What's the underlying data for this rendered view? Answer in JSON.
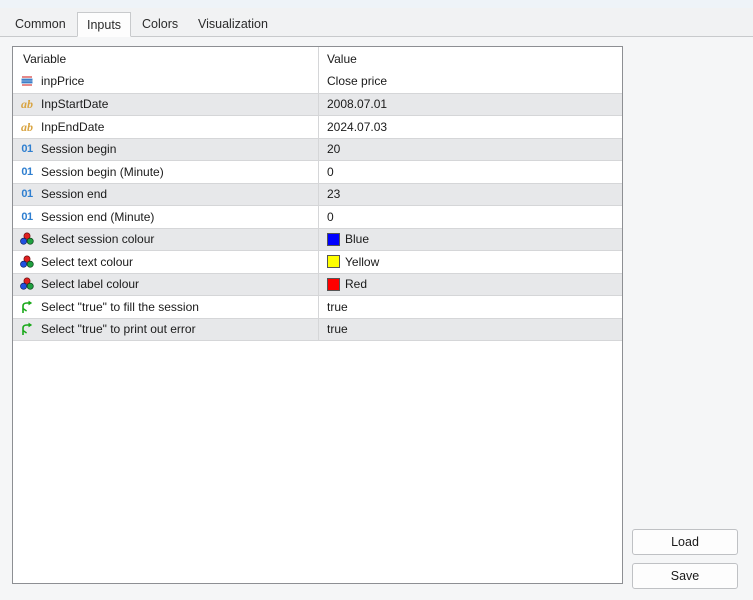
{
  "window": {
    "tabs": [
      {
        "label": "Common",
        "active": false
      },
      {
        "label": "Inputs",
        "active": true
      },
      {
        "label": "Colors",
        "active": false
      },
      {
        "label": "Visualization",
        "active": false
      }
    ]
  },
  "table": {
    "headers": {
      "variable": "Variable",
      "value": "Value"
    },
    "rows": [
      {
        "icon": "price-type-icon",
        "label": "inpPrice",
        "value": "Close price",
        "swatch": null
      },
      {
        "icon": "string-ab-icon",
        "label": "InpStartDate",
        "value": "2008.07.01",
        "swatch": null
      },
      {
        "icon": "string-ab-icon",
        "label": "InpEndDate",
        "value": "2024.07.03",
        "swatch": null
      },
      {
        "icon": "integer-01-icon",
        "label": "Session begin",
        "value": "20",
        "swatch": null
      },
      {
        "icon": "integer-01-icon",
        "label": "Session begin (Minute)",
        "value": "0",
        "swatch": null
      },
      {
        "icon": "integer-01-icon",
        "label": "Session end",
        "value": "23",
        "swatch": null
      },
      {
        "icon": "integer-01-icon",
        "label": "Session end (Minute)",
        "value": "0",
        "swatch": null
      },
      {
        "icon": "color-circles-icon",
        "label": "Select session colour",
        "value": "Blue",
        "swatch": "#0000FF"
      },
      {
        "icon": "color-circles-icon",
        "label": "Select text colour",
        "value": "Yellow",
        "swatch": "#FFFF00"
      },
      {
        "icon": "color-circles-icon",
        "label": "Select label colour",
        "value": "Red",
        "swatch": "#FF0000"
      },
      {
        "icon": "bool-branch-icon",
        "label": "Select \"true\" to fill the session",
        "value": "true",
        "swatch": null
      },
      {
        "icon": "bool-branch-icon",
        "label": "Select \"true\" to print out error",
        "value": "true",
        "swatch": null
      }
    ]
  },
  "buttons": {
    "load": "Load",
    "save": "Save"
  },
  "colors": {
    "blue": "#0000FF",
    "yellow": "#FFFF00",
    "red": "#FF0000",
    "row_shade": "#e7e8ea",
    "grid_line": "#d5d6d8",
    "frame": "#8d8f93"
  }
}
